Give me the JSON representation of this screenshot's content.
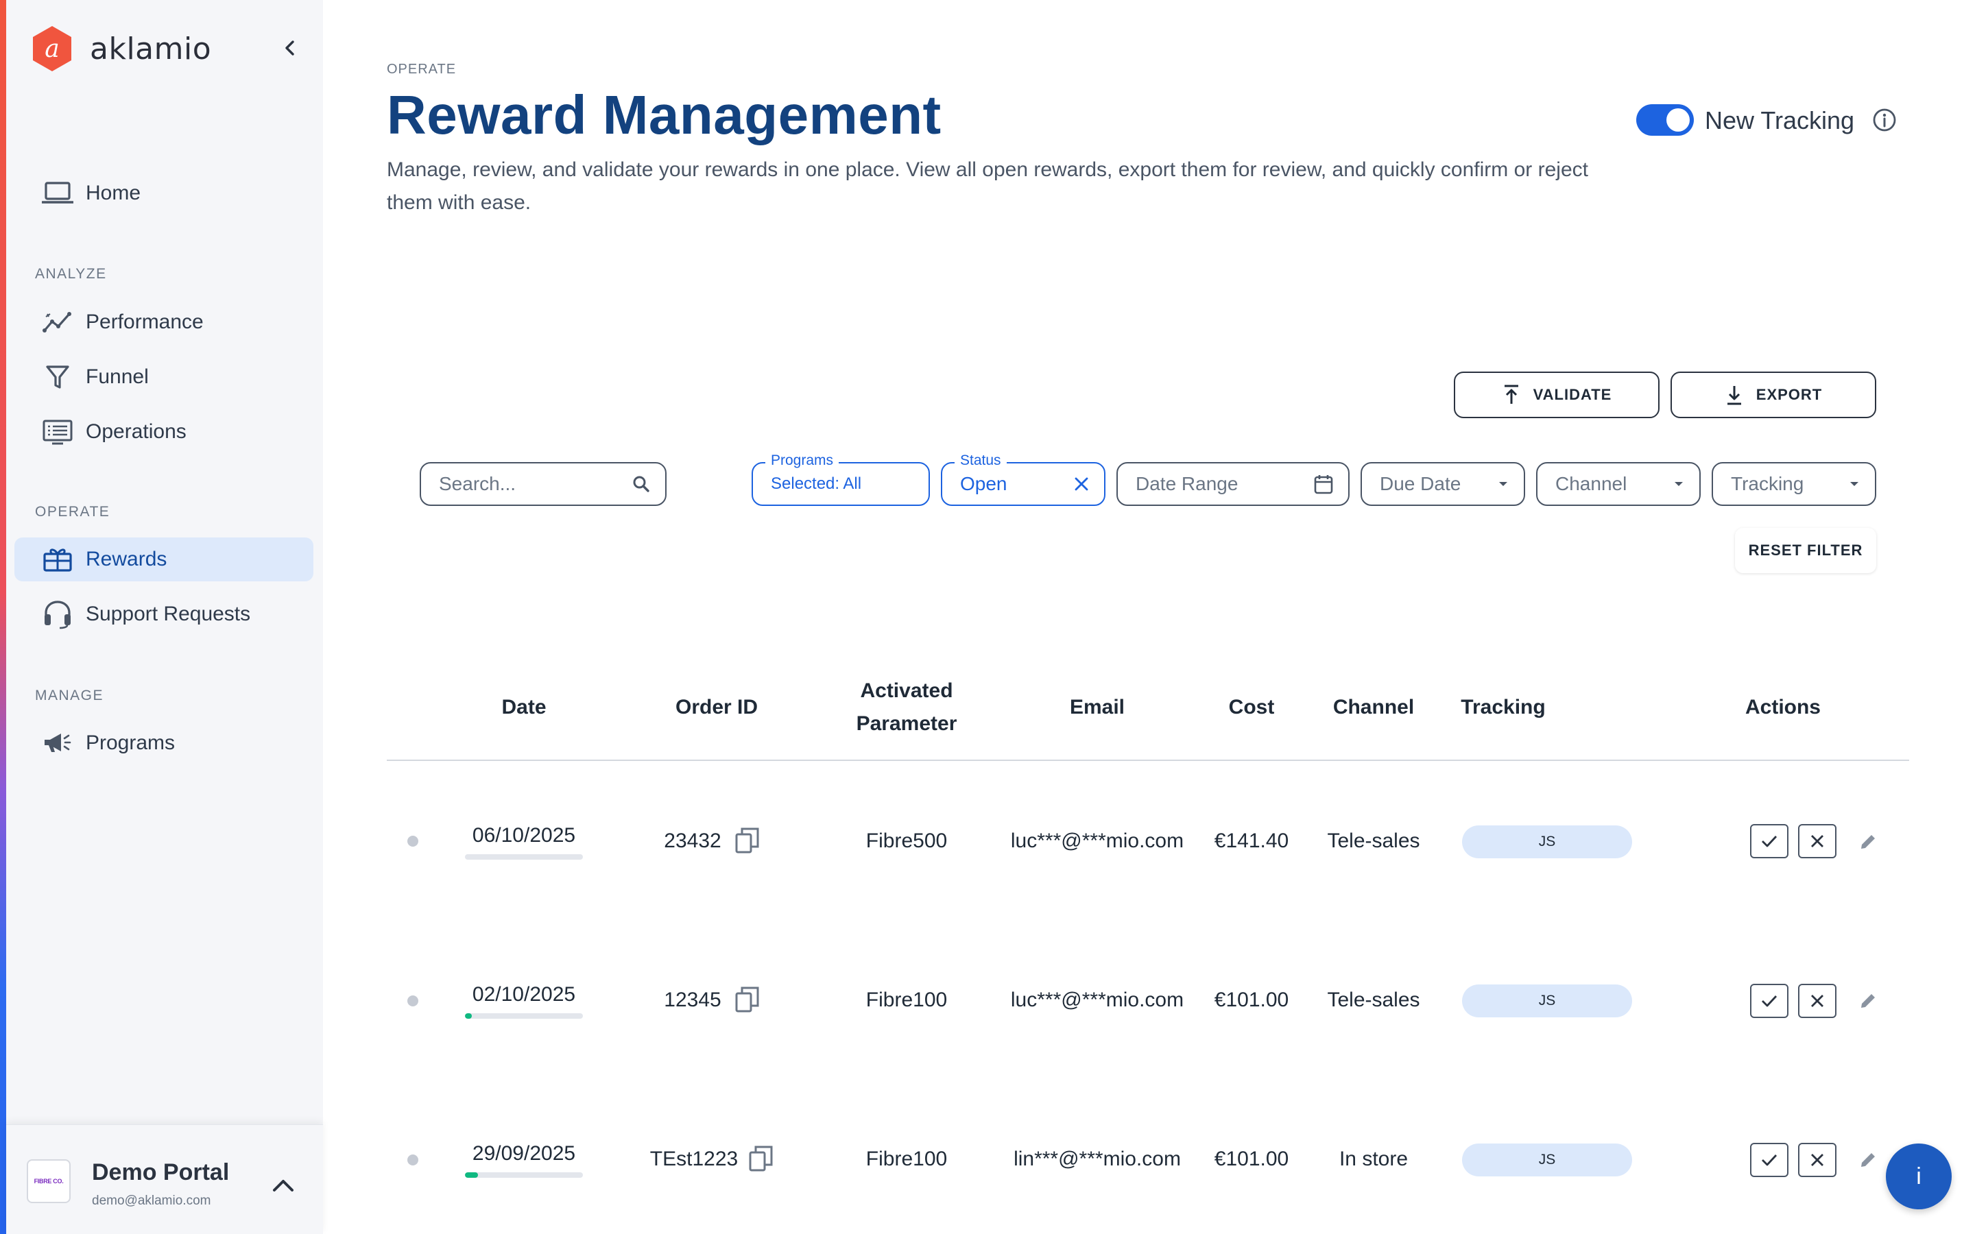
{
  "brand": {
    "name": "aklamio",
    "logo_letter": "a",
    "accent": "#f0553e"
  },
  "sidebar": {
    "items": [
      {
        "label": "Home",
        "icon": "laptop-icon"
      },
      {
        "label": "Performance",
        "icon": "trend-icon"
      },
      {
        "label": "Funnel",
        "icon": "funnel-icon"
      },
      {
        "label": "Operations",
        "icon": "operations-icon"
      },
      {
        "label": "Rewards",
        "icon": "gift-icon"
      },
      {
        "label": "Support Requests",
        "icon": "headset-icon"
      },
      {
        "label": "Programs",
        "icon": "megaphone-icon"
      }
    ],
    "sections": {
      "analyze": "ANALYZE",
      "operate": "OPERATE",
      "manage": "MANAGE"
    },
    "active": "Rewards"
  },
  "user": {
    "name": "Demo Portal",
    "email": "demo@aklamio.com",
    "logo_text": "FIBRE CO."
  },
  "header": {
    "breadcrumb": "OPERATE",
    "title": "Reward Management",
    "description": "Manage, review, and validate your rewards in one place. View all open rewards, export them for review, and quickly confirm or reject them with ease.",
    "toggle_label": "New Tracking",
    "toggle_on": true
  },
  "actions": {
    "validate": "VALIDATE",
    "export": "EXPORT",
    "reset": "RESET FILTER"
  },
  "filters": {
    "search_placeholder": "Search...",
    "programs_label": "Programs",
    "programs_value": "Selected: All",
    "status_label": "Status",
    "status_value": "Open",
    "date_range": "Date Range",
    "due_date": "Due Date",
    "channel": "Channel",
    "tracking": "Tracking"
  },
  "table": {
    "headers": {
      "date": "Date",
      "order_id": "Order ID",
      "activated_parameter": "Activated Parameter",
      "email": "Email",
      "cost": "Cost",
      "channel": "Channel",
      "tracking": "Tracking",
      "actions": "Actions"
    },
    "rows": [
      {
        "date": "06/10/2025",
        "order_id": "23432",
        "param": "Fibre500",
        "email": "luc***@***mio.com",
        "cost": "€141.40",
        "channel": "Tele-sales",
        "tracking": "JS",
        "progress": 0.0
      },
      {
        "date": "02/10/2025",
        "order_id": "12345",
        "param": "Fibre100",
        "email": "luc***@***mio.com",
        "cost": "€101.00",
        "channel": "Tele-sales",
        "tracking": "JS",
        "progress": 0.06
      },
      {
        "date": "29/09/2025",
        "order_id": "TEst1223",
        "param": "Fibre100",
        "email": "lin***@***mio.com",
        "cost": "€101.00",
        "channel": "In store",
        "tracking": "JS",
        "progress": 0.11
      }
    ]
  },
  "fab": {
    "label": "i"
  },
  "colors": {
    "primary": "#1d63e0",
    "title": "#13427f",
    "success": "#10b981",
    "pill": "#dbe8fb"
  }
}
